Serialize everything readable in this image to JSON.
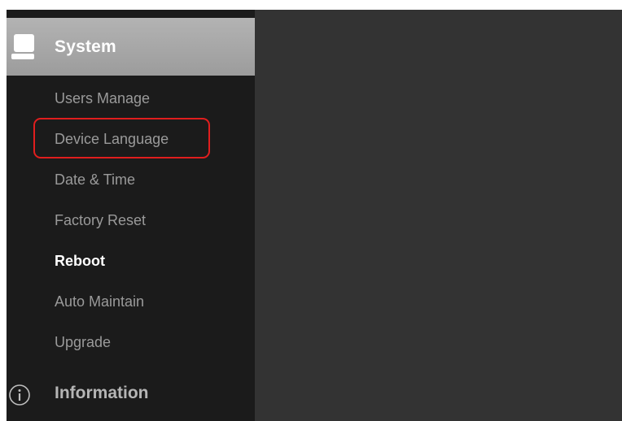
{
  "sidebar": {
    "system": {
      "label": "System",
      "icon": "computer-icon"
    },
    "items": [
      {
        "label": "Users Manage",
        "active": false
      },
      {
        "label": "Device Language",
        "active": false,
        "highlighted": true
      },
      {
        "label": "Date & Time",
        "active": false
      },
      {
        "label": "Factory Reset",
        "active": false
      },
      {
        "label": "Reboot",
        "active": true
      },
      {
        "label": "Auto Maintain",
        "active": false
      },
      {
        "label": "Upgrade",
        "active": false
      }
    ],
    "information": {
      "label": "Information",
      "icon": "info-icon"
    }
  },
  "colors": {
    "sidebar_bg": "#1b1b1b",
    "content_bg": "#333333",
    "header_bg": "#a8a8a8",
    "highlight": "#e01e1e"
  }
}
